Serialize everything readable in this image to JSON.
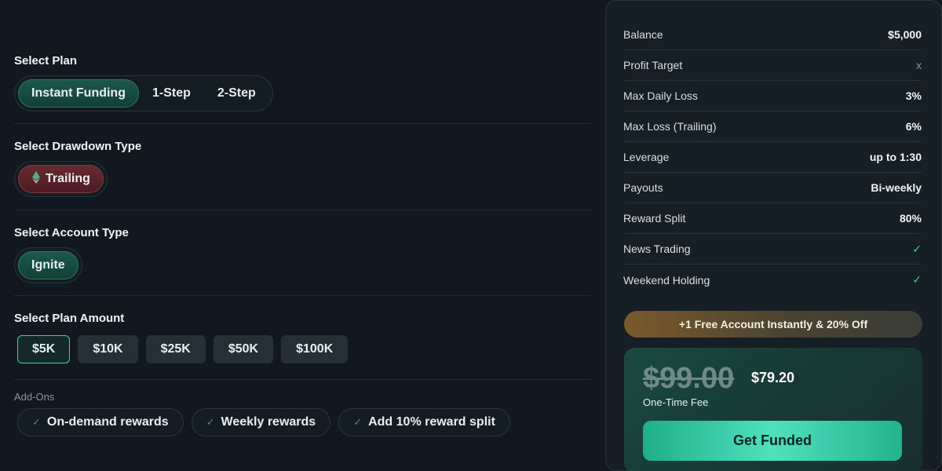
{
  "plan": {
    "title": "Select Plan",
    "options": [
      "Instant Funding",
      "1-Step",
      "2-Step"
    ]
  },
  "drawdown": {
    "title": "Select Drawdown Type",
    "options": [
      "Trailing"
    ]
  },
  "account": {
    "title": "Select Account Type",
    "options": [
      "Ignite"
    ]
  },
  "amount": {
    "title": "Select Plan Amount",
    "options": [
      "$5K",
      "$10K",
      "$25K",
      "$50K",
      "$100K"
    ]
  },
  "addons": {
    "title": "Add-Ons",
    "items": [
      "On-demand rewards",
      "Weekly rewards",
      "Add 10% reward split"
    ]
  },
  "summary": {
    "rows": [
      {
        "label": "Balance",
        "value": "$5,000"
      },
      {
        "label": "Profit Target",
        "value": "x"
      },
      {
        "label": "Max Daily Loss",
        "value": "3%"
      },
      {
        "label": "Max Loss (Trailing)",
        "value": "6%"
      },
      {
        "label": "Leverage",
        "value": "up to 1:30"
      },
      {
        "label": "Payouts",
        "value": "Bi-weekly"
      },
      {
        "label": "Reward Split",
        "value": "80%"
      },
      {
        "label": "News Trading",
        "value": "✓"
      },
      {
        "label": "Weekend Holding",
        "value": "✓"
      }
    ],
    "promo": "+1 Free Account Instantly & 20% Off",
    "old_price": "$99.00",
    "new_price": "$79.20",
    "fee_label": "One-Time Fee",
    "cta_label": "Get Funded"
  },
  "colors": {
    "accent": "#3fd0a8",
    "check": "#34d39e",
    "background": "#111820"
  }
}
